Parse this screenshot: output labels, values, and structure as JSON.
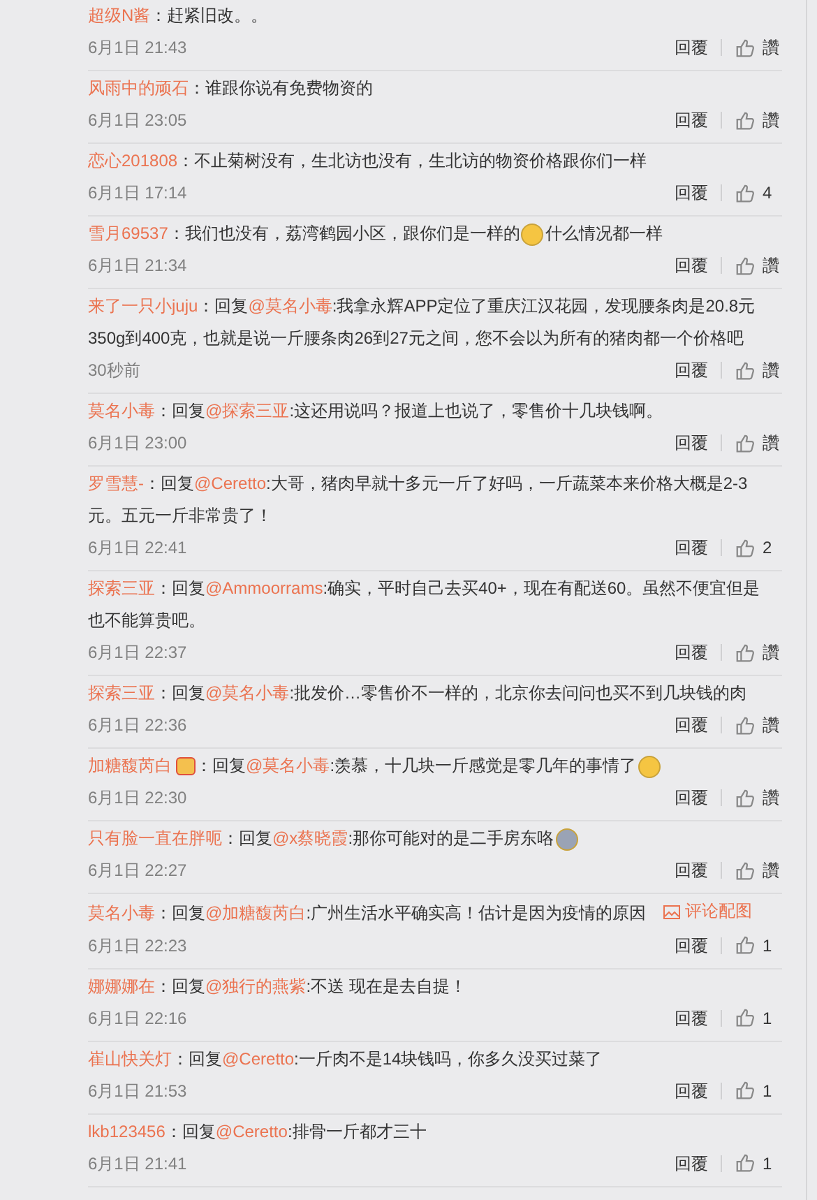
{
  "comments": [
    {
      "author": "超级N酱",
      "body": [
        {
          "kind": "text",
          "text": "：赶紧旧改。。"
        }
      ],
      "time": "6月1日 21:43",
      "reply_label": "回覆",
      "like": "讚"
    },
    {
      "author": "风雨中的顽石",
      "body": [
        {
          "kind": "text",
          "text": "：谁跟你说有免费物资的"
        }
      ],
      "time": "6月1日 23:05",
      "reply_label": "回覆",
      "like": "讚"
    },
    {
      "author": "恋心201808",
      "body": [
        {
          "kind": "text",
          "text": "：不止菊树没有，生北访也没有，生北访的物资价格跟你们一样"
        }
      ],
      "time": "6月1日 17:14",
      "reply_label": "回覆",
      "like": "4"
    },
    {
      "author": "雪月69537",
      "body": [
        {
          "kind": "text",
          "text": "：我们也没有，荔湾鹤园小区，跟你们是一样的"
        },
        {
          "kind": "emoji",
          "color": "#f5c542"
        },
        {
          "kind": "text",
          "text": "什么情况都一样"
        }
      ],
      "time": "6月1日 21:34",
      "reply_label": "回覆",
      "like": "讚"
    },
    {
      "author": "来了一只小juju",
      "body": [
        {
          "kind": "text",
          "text": "：回复"
        },
        {
          "kind": "mention",
          "text": "@莫名小毒"
        },
        {
          "kind": "text",
          "text": ":我拿永辉APP定位了重庆江汉花园，发现腰条肉是20.8元350g到400克，也就是说一斤腰条肉26到27元之间，您不会以为所有的猪肉都一个价格吧"
        }
      ],
      "time": "30秒前",
      "reply_label": "回覆",
      "like": "讚"
    },
    {
      "author": "莫名小毒",
      "body": [
        {
          "kind": "text",
          "text": "：回复"
        },
        {
          "kind": "mention",
          "text": "@探索三亚"
        },
        {
          "kind": "text",
          "text": ":这还用说吗？报道上也说了，零售价十几块钱啊。"
        }
      ],
      "time": "6月1日 23:00",
      "reply_label": "回覆",
      "like": "讚"
    },
    {
      "author": "罗雪慧-",
      "body": [
        {
          "kind": "text",
          "text": "：回复"
        },
        {
          "kind": "mention",
          "text": "@Ceretto"
        },
        {
          "kind": "text",
          "text": ":大哥，猪肉早就十多元一斤了好吗，一斤蔬菜本来价格大概是2-3元。五元一斤非常贵了！"
        }
      ],
      "time": "6月1日 22:41",
      "reply_label": "回覆",
      "like": "2"
    },
    {
      "author": "探索三亚",
      "body": [
        {
          "kind": "text",
          "text": "：回复"
        },
        {
          "kind": "mention",
          "text": "@Ammoorrams"
        },
        {
          "kind": "text",
          "text": ":确实，平时自己去买40+，现在有配送60。虽然不便宜但是也不能算贵吧。"
        }
      ],
      "time": "6月1日 22:37",
      "reply_label": "回覆",
      "like": "讚"
    },
    {
      "author": "探索三亚",
      "body": [
        {
          "kind": "text",
          "text": "：回复"
        },
        {
          "kind": "mention",
          "text": "@莫名小毒"
        },
        {
          "kind": "text",
          "text": ":批发价…零售价不一样的，北京你去问问也买不到几块钱的肉"
        }
      ],
      "time": "6月1日 22:36",
      "reply_label": "回覆",
      "like": "讚"
    },
    {
      "author": "加糖馥芮白",
      "badge": true,
      "body": [
        {
          "kind": "text",
          "text": "：回复"
        },
        {
          "kind": "mention",
          "text": "@莫名小毒"
        },
        {
          "kind": "text",
          "text": ":羡慕，十几块一斤感觉是零几年的事情了"
        },
        {
          "kind": "emoji",
          "color": "#f5c542"
        }
      ],
      "time": "6月1日 22:30",
      "reply_label": "回覆",
      "like": "讚"
    },
    {
      "author": "只有脸一直在胖呃",
      "body": [
        {
          "kind": "text",
          "text": "：回复"
        },
        {
          "kind": "mention",
          "text": "@x蔡晓霞"
        },
        {
          "kind": "text",
          "text": ":那你可能对的是二手房东咯"
        },
        {
          "kind": "emoji",
          "color": "#9aa3b5"
        }
      ],
      "time": "6月1日 22:27",
      "reply_label": "回覆",
      "like": "讚"
    },
    {
      "author": "莫名小毒",
      "body": [
        {
          "kind": "text",
          "text": "：回复"
        },
        {
          "kind": "mention",
          "text": "@加糖馥芮白"
        },
        {
          "kind": "text",
          "text": ":广州生活水平确实高！估计是因为疫情的原因"
        }
      ],
      "image_link": "评论配图",
      "time": "6月1日 22:23",
      "reply_label": "回覆",
      "like": "1"
    },
    {
      "author": "娜娜娜在",
      "body": [
        {
          "kind": "text",
          "text": "：回复"
        },
        {
          "kind": "mention",
          "text": "@独行的燕紫"
        },
        {
          "kind": "text",
          "text": ":不送 现在是去自提！"
        }
      ],
      "time": "6月1日 22:16",
      "reply_label": "回覆",
      "like": "1"
    },
    {
      "author": "崔山快关灯",
      "body": [
        {
          "kind": "text",
          "text": "：回复"
        },
        {
          "kind": "mention",
          "text": "@Ceretto"
        },
        {
          "kind": "text",
          "text": ":一斤肉不是14块钱吗，你多久没买过菜了"
        }
      ],
      "time": "6月1日 21:53",
      "reply_label": "回覆",
      "like": "1"
    },
    {
      "author": "lkb123456",
      "body": [
        {
          "kind": "text",
          "text": "：回复"
        },
        {
          "kind": "mention",
          "text": "@Ceretto"
        },
        {
          "kind": "text",
          "text": ":排骨一斤都才三十"
        }
      ],
      "time": "6月1日 21:41",
      "reply_label": "回覆",
      "like": "1"
    }
  ]
}
